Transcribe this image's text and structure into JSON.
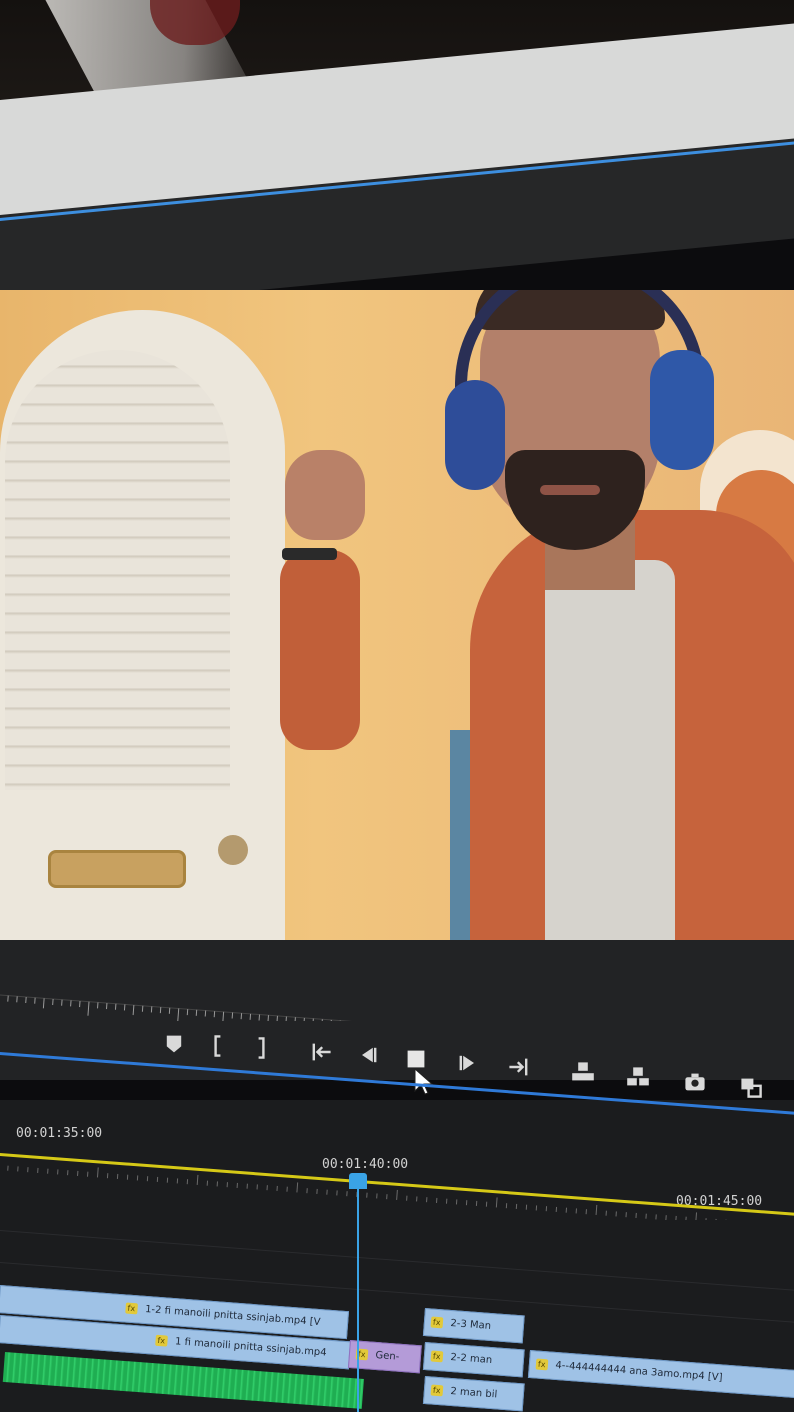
{
  "timeline": {
    "timecodes": [
      "00:01:35:00",
      "00:01:40:00",
      "00:01:45:00"
    ],
    "clips": {
      "v2_top": "1-2 fi manoili pnitta ssinjab.mp4 [V",
      "v1_main": "1 fi manoili pnitta ssinjab.mp4",
      "pink": "Gen-",
      "c23": "2-3 Man",
      "c22": "2-2 man",
      "c2bil": "2 man bil",
      "c4": "4--444444444 ana 3amo.mp4 [V]"
    },
    "fx_label": "fx"
  },
  "controls": {
    "icons": [
      "marker-icon",
      "mark-in-icon",
      "mark-out-icon",
      "go-to-in-icon",
      "step-back-icon",
      "stop-icon",
      "step-forward-icon",
      "go-to-out-icon",
      "lift-icon",
      "extract-icon",
      "camera-icon",
      "compare-icon"
    ]
  }
}
